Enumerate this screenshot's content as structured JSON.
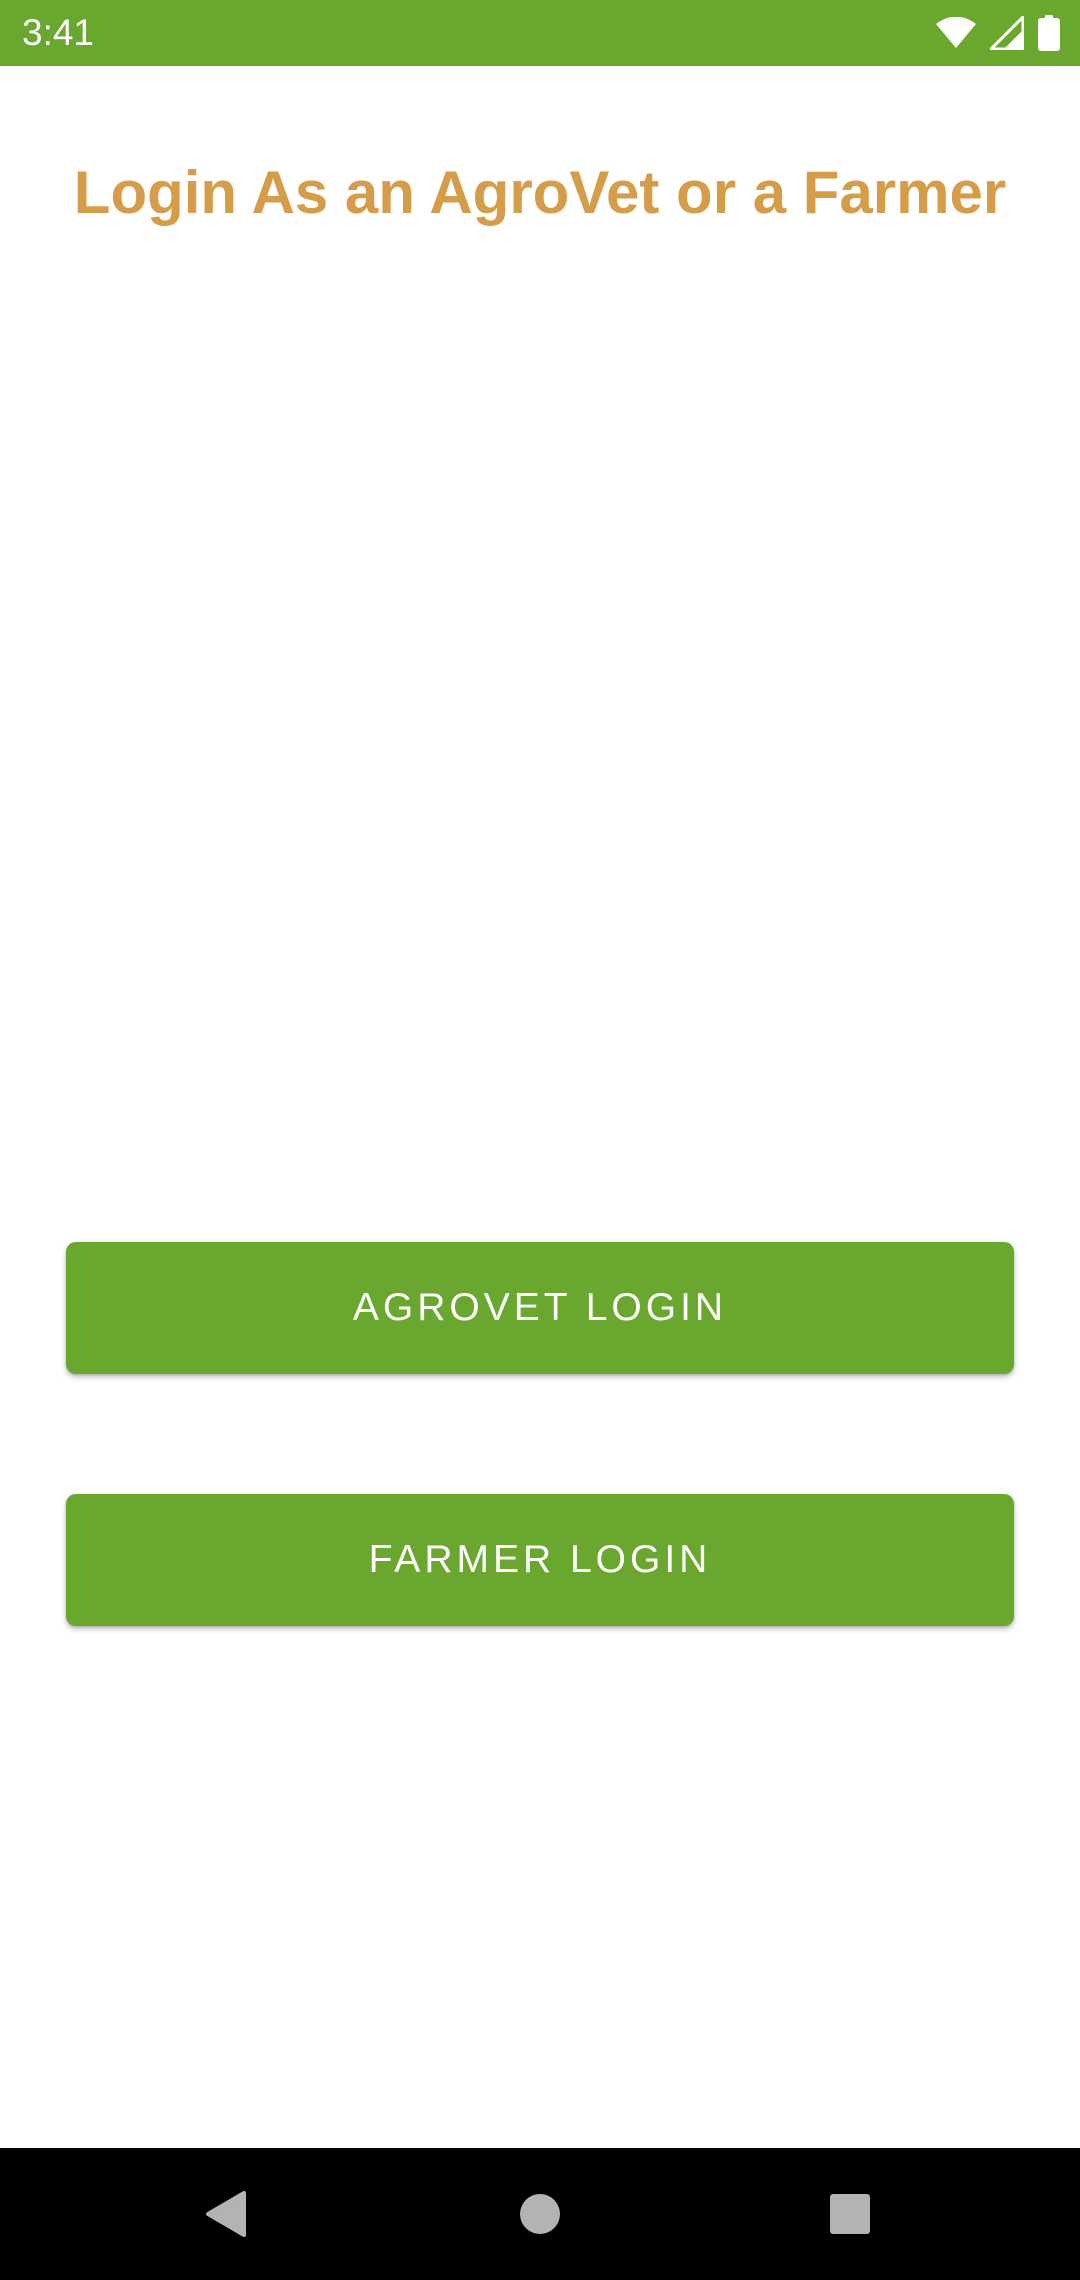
{
  "status_bar": {
    "time": "3:41",
    "icons": [
      "wifi-icon",
      "cellular-signal-icon",
      "battery-icon"
    ],
    "background_color": "#6aa72f"
  },
  "header": {
    "title": "Login As an AgroVet or a Farmer",
    "title_color": "#d59d49"
  },
  "buttons": {
    "agrovet_login_label": "AGROVET LOGIN",
    "farmer_login_label": "FARMER LOGIN",
    "button_color": "#6aa72f"
  },
  "nav_bar": {
    "icons": [
      "back-icon",
      "home-icon",
      "recents-icon"
    ]
  }
}
